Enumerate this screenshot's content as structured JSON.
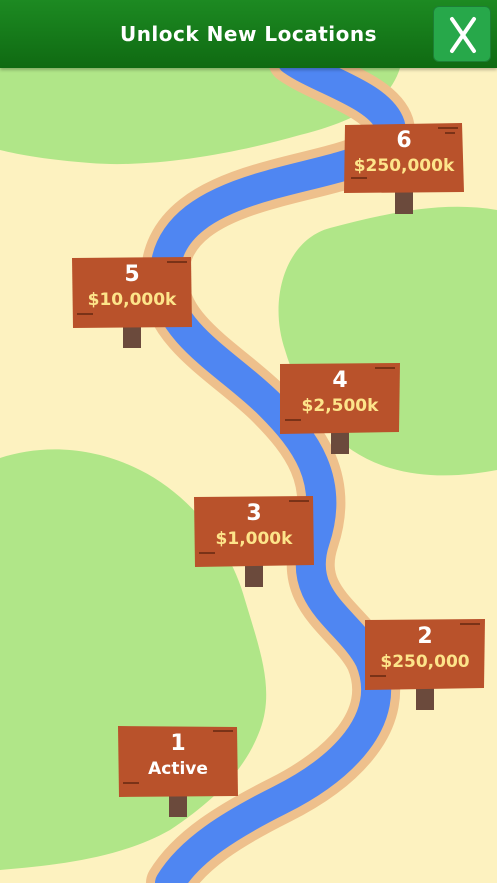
{
  "header": {
    "title": "Unlock New Locations",
    "close_label": "X"
  },
  "colors": {
    "header_green": "#137516",
    "close_green": "#27a84a",
    "sand": "#fdf2c0",
    "grass": "#b0e688",
    "river": "#4f86f2",
    "river_bank": "#eec08c",
    "sign_wood": "#b9522b",
    "price_text": "#fde48a"
  },
  "locations": [
    {
      "number": "1",
      "label": "Active",
      "status": "active"
    },
    {
      "number": "2",
      "label": "$250,000",
      "status": "locked"
    },
    {
      "number": "3",
      "label": "$1,000k",
      "status": "locked"
    },
    {
      "number": "4",
      "label": "$2,500k",
      "status": "locked"
    },
    {
      "number": "5",
      "label": "$10,000k",
      "status": "locked"
    },
    {
      "number": "6",
      "label": "$250,000k",
      "status": "locked"
    }
  ]
}
